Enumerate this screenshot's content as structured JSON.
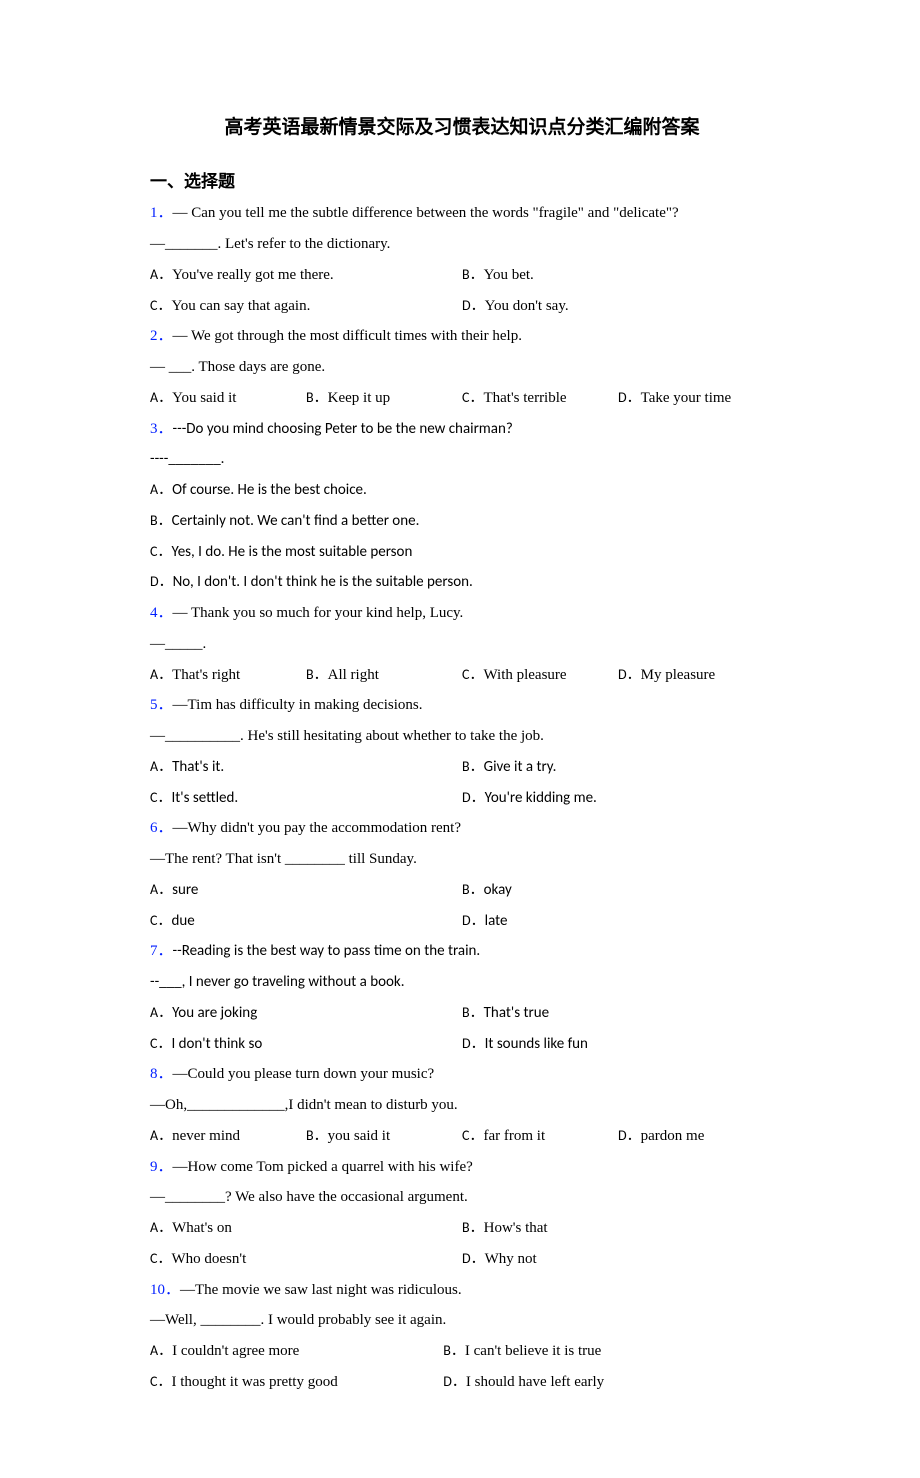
{
  "title": "高考英语最新情景交际及习惯表达知识点分类汇编附答案",
  "section": "一、选择题",
  "questions": [
    {
      "num": "1．",
      "lines": [
        "— Can you tell me the subtle difference between the words \"fragile\" and \"delicate\"?",
        "—_______. Let's refer to the dictionary."
      ],
      "options": [
        {
          "l": "A．",
          "t": "You've really got me there."
        },
        {
          "l": "B．",
          "t": "You bet."
        },
        {
          "l": "C．",
          "t": "You can say that again."
        },
        {
          "l": "D．",
          "t": "You don't say."
        }
      ],
      "cols": 2,
      "font": "tnr"
    },
    {
      "num": "2．",
      "lines": [
        "— We got through the most difficult times with their help.",
        "—  ___. Those days are gone."
      ],
      "options": [
        {
          "l": "A．",
          "t": "You said it"
        },
        {
          "l": "B．",
          "t": "Keep it up"
        },
        {
          "l": "C．",
          "t": "That's terrible"
        },
        {
          "l": "D．",
          "t": "Take your time"
        }
      ],
      "cols": 4,
      "font": "tnr"
    },
    {
      "num": "3．",
      "lines": [
        "---Do you mind choosing Peter to be the new chairman?",
        "----_______."
      ],
      "options": [
        {
          "l": "A．",
          "t": "Of course. He is the best choice."
        },
        {
          "l": "B．",
          "t": "Certainly not. We can't find a better one."
        },
        {
          "l": "C．",
          "t": "Yes, I do. He is the most suitable person"
        },
        {
          "l": "D．",
          "t": "No, I don't. I don't think he is the suitable person."
        }
      ],
      "cols": 1,
      "font": "calibri"
    },
    {
      "num": "4．",
      "lines": [
        "— Thank you so much for your kind help, Lucy.",
        "—_____."
      ],
      "options": [
        {
          "l": "A．",
          "t": "That's right"
        },
        {
          "l": "B．",
          "t": "All right"
        },
        {
          "l": "C．",
          "t": "With pleasure"
        },
        {
          "l": "D．",
          "t": "My pleasure"
        }
      ],
      "cols": 4,
      "font": "tnr"
    },
    {
      "num": "5．",
      "lines": [
        "—Tim has difficulty in making decisions.",
        "—__________. He's still hesitating about whether to take the job."
      ],
      "options": [
        {
          "l": "A．",
          "t": "That's it."
        },
        {
          "l": "B．",
          "t": "Give it a try."
        },
        {
          "l": "C．",
          "t": "It's settled."
        },
        {
          "l": "D．",
          "t": "You're kidding me."
        }
      ],
      "cols": 2,
      "font": "tnr",
      "optfont": "calibri"
    },
    {
      "num": "6．",
      "lines": [
        "—Why didn't you pay the accommodation rent?",
        "—The rent? That isn't ________ till Sunday."
      ],
      "options": [
        {
          "l": "A．",
          "t": "sure"
        },
        {
          "l": "B．",
          "t": "okay"
        },
        {
          "l": "C．",
          "t": "due"
        },
        {
          "l": "D．",
          "t": "late"
        }
      ],
      "cols": 2,
      "font": "tnr",
      "optfont": "calibri"
    },
    {
      "num": "7．",
      "lines": [
        "--Reading is the best way to pass time on the train.",
        "--___, I never go traveling without a book."
      ],
      "options": [
        {
          "l": "A．",
          "t": "You are joking"
        },
        {
          "l": "B．",
          "t": "That's true"
        },
        {
          "l": "C．",
          "t": "I don't think so"
        },
        {
          "l": "D．",
          "t": "It sounds like fun"
        }
      ],
      "cols": 2,
      "font": "calibri",
      "optfont": "calibri"
    },
    {
      "num": "8．",
      "lines": [
        "—Could you please turn down your music?",
        "—Oh,_____________,I didn't mean to disturb you."
      ],
      "options": [
        {
          "l": "A．",
          "t": "never mind"
        },
        {
          "l": "B．",
          "t": "you said it"
        },
        {
          "l": "C．",
          "t": "far from it"
        },
        {
          "l": "D．",
          "t": "pardon me"
        }
      ],
      "cols": 4,
      "font": "tnr"
    },
    {
      "num": "9．",
      "lines": [
        "—How come Tom picked a quarrel with his wife?",
        "—________? We also have the occasional argument."
      ],
      "options": [
        {
          "l": "A．",
          "t": "What's on"
        },
        {
          "l": "B．",
          "t": "How's that"
        },
        {
          "l": "C．",
          "t": "Who doesn't"
        },
        {
          "l": "D．",
          "t": "Why not"
        }
      ],
      "cols": 2,
      "font": "tnr"
    },
    {
      "num": "10．",
      "lines": [
        "—The movie we saw last night was ridiculous.",
        "—Well, ________. I would probably see it again."
      ],
      "options": [
        {
          "l": "A．",
          "t": "I couldn't agree more"
        },
        {
          "l": "B．",
          "t": "I can't believe it is true"
        },
        {
          "l": "C．",
          "t": "I thought it was pretty good"
        },
        {
          "l": "D．",
          "t": "I should have left early"
        }
      ],
      "cols": 2,
      "font": "tnr",
      "cols2b": true
    }
  ]
}
